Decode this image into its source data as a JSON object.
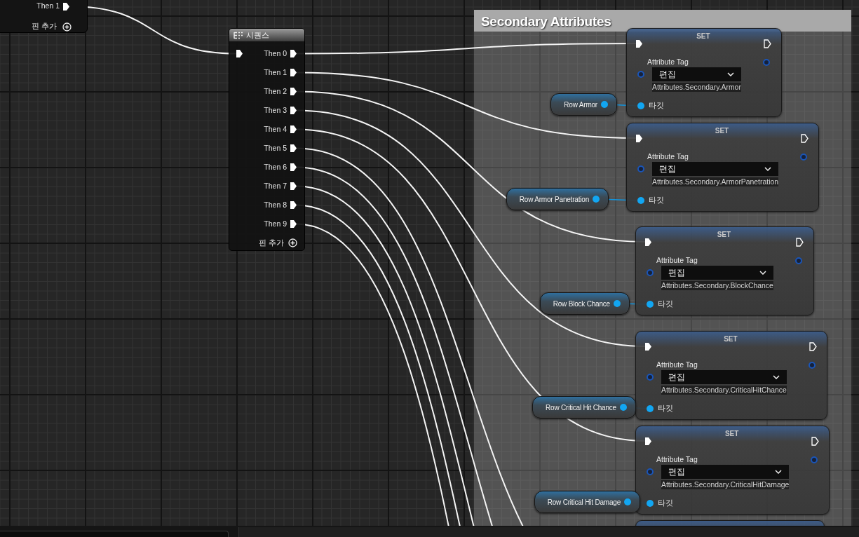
{
  "upper_node": {
    "pins": [
      {
        "label": "Then 1"
      }
    ],
    "add_pin": "핀 추가"
  },
  "sequence": {
    "title": "시퀀스",
    "outputs": [
      {
        "label": "Then 0"
      },
      {
        "label": "Then 1"
      },
      {
        "label": "Then 2"
      },
      {
        "label": "Then 3"
      },
      {
        "label": "Then 4"
      },
      {
        "label": "Then 5"
      },
      {
        "label": "Then 6"
      },
      {
        "label": "Then 7"
      },
      {
        "label": "Then 8"
      },
      {
        "label": "Then 9"
      }
    ],
    "add_pin": "핀 추가"
  },
  "comment": {
    "title": "Secondary Attributes"
  },
  "set_nodes": [
    {
      "kind": "full",
      "title": "SET",
      "param_label": "Attribute Tag",
      "dropdown": "편집",
      "tag": "Attributes.Secondary.Armor",
      "target_label": "타깃",
      "variable": "Row Armor"
    },
    {
      "kind": "full",
      "title": "SET",
      "param_label": "Attribute Tag",
      "dropdown": "편집",
      "tag": "Attributes.Secondary.ArmorPanetration",
      "target_label": "타깃",
      "variable": "Row Armor Panetration"
    },
    {
      "kind": "full",
      "title": "SET",
      "param_label": "Attribute Tag",
      "dropdown": "편집",
      "tag": "Attributes.Secondary.BlockChance",
      "target_label": "타깃",
      "variable": "Row Block Chance"
    },
    {
      "kind": "full",
      "title": "SET",
      "param_label": "Attribute Tag",
      "dropdown": "편집",
      "tag": "Attributes.Secondary.CriticalHitChance",
      "target_label": "타깃",
      "variable": "Row Critical Hit Chance"
    },
    {
      "kind": "full",
      "title": "SET",
      "param_label": "Attribute Tag",
      "dropdown": "편집",
      "tag": "Attributes.Secondary.CriticalHitDamage",
      "target_label": "타깃",
      "variable": "Row Critical Hit Damage"
    },
    {
      "kind": "cut"
    }
  ]
}
